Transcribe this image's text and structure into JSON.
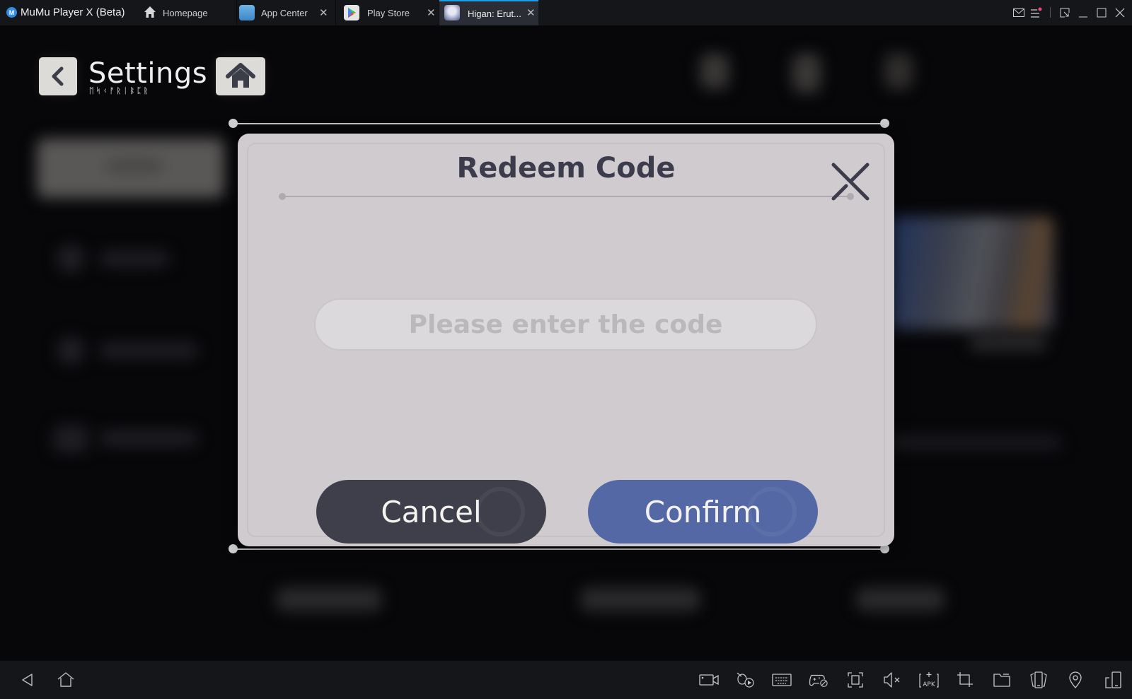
{
  "app": {
    "logo_letter": "M",
    "title": "MuMu Player X  (Beta)"
  },
  "tabs": [
    {
      "label": "Homepage",
      "icon": "home-icon",
      "closable": false
    },
    {
      "label": "App Center",
      "icon": "app-center-icon",
      "closable": true
    },
    {
      "label": "Play Store",
      "icon": "play-store-icon",
      "closable": true
    },
    {
      "label": "Higan: Erut...",
      "icon": "game-avatar-icon",
      "closable": true,
      "active": true
    }
  ],
  "tab_close_glyph": "✕",
  "window_controls": [
    "mail-icon",
    "menu-icon",
    "restore-window-icon",
    "minimize-icon",
    "maximize-icon",
    "close-window-icon"
  ],
  "colors": {
    "active_tab_accent": "#1f9be8",
    "notification_dot": "#f0457a",
    "dialog_bg": "#cfcbcf",
    "cancel_bg": "#3f3f4b",
    "confirm_bg": "#5468a5",
    "title_text": "#3c3c4c"
  },
  "game": {
    "header": {
      "title": "Settings",
      "subtitle": "ᛖᛋᚲᚠᚱᛁᛒᛈᚱ"
    }
  },
  "dialog": {
    "title": "Redeem Code",
    "input": {
      "value": "",
      "placeholder": "Please enter the code"
    },
    "cancel_label": "Cancel",
    "confirm_label": "Confirm"
  },
  "bottom_toolbar": {
    "left": [
      "back-icon",
      "home-icon"
    ],
    "right": [
      "screen-record-icon",
      "operation-record-icon",
      "keyboard-icon",
      "gamepad-icon",
      "fullscreen-icon",
      "mute-icon",
      "install-apk-icon",
      "crop-screenshot-icon",
      "shared-folder-icon",
      "shake-icon",
      "location-icon",
      "multi-instance-icon"
    ],
    "apk_label": "APK"
  }
}
